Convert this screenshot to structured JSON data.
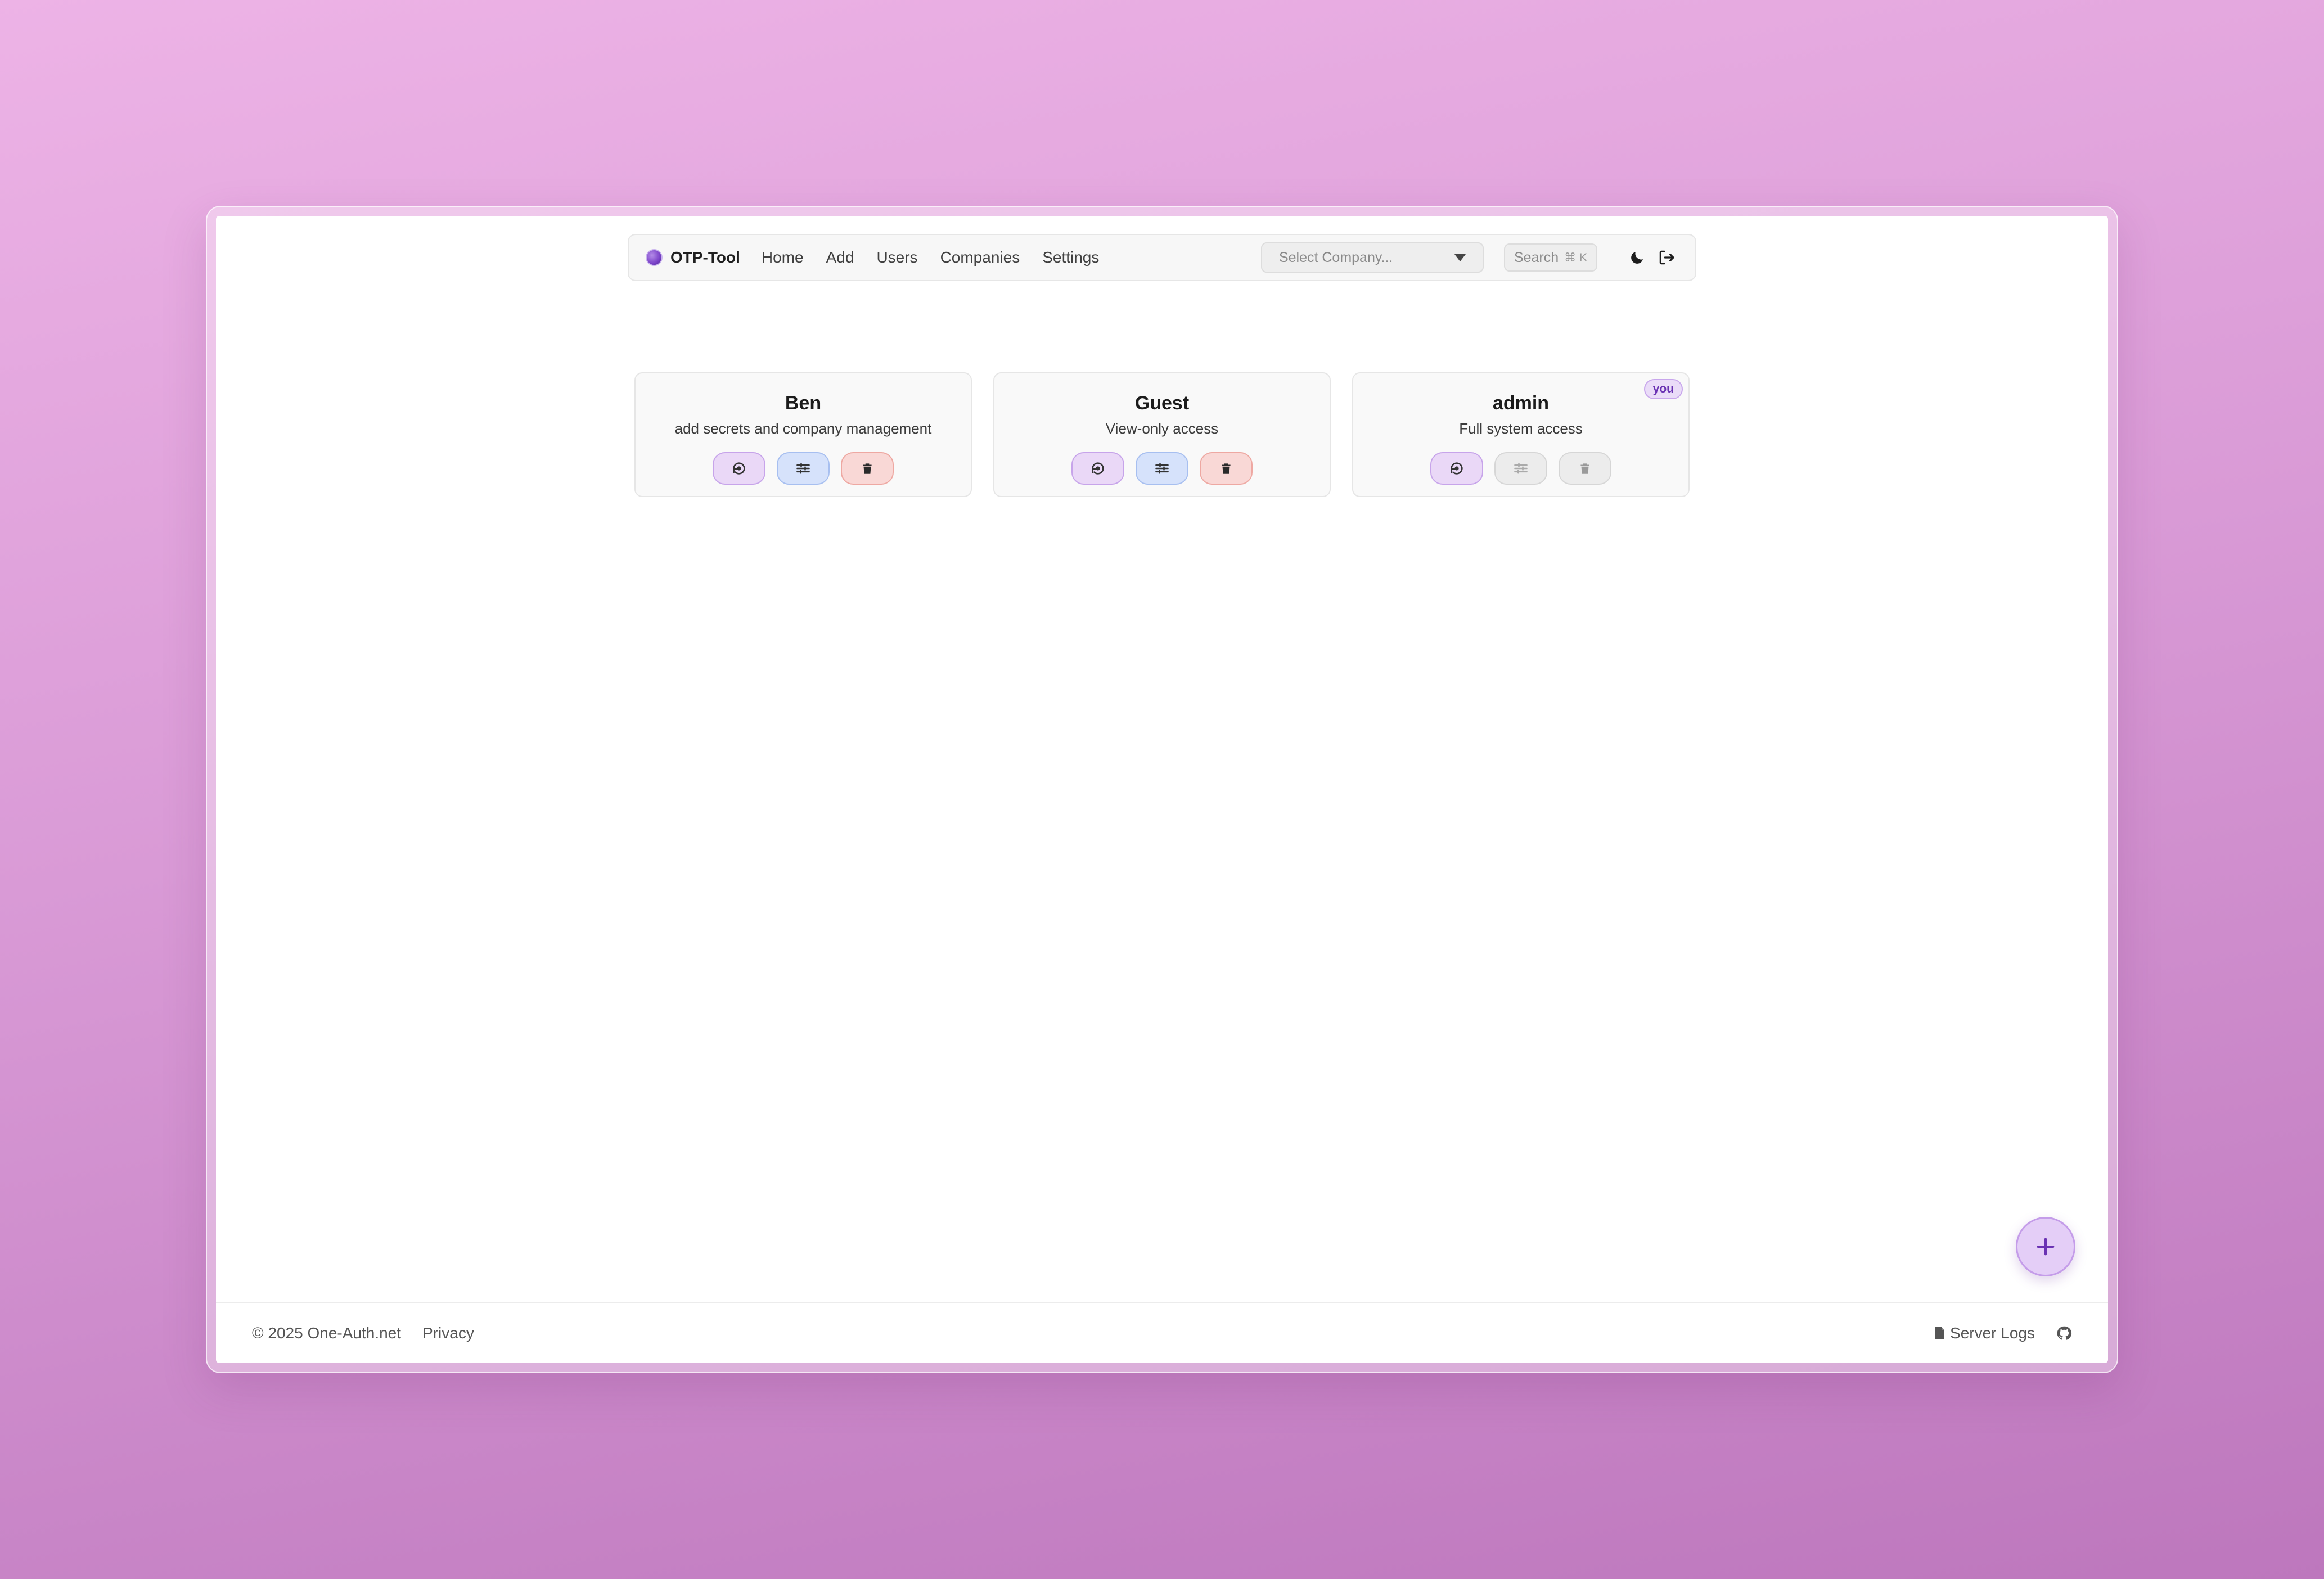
{
  "nav": {
    "brand": "OTP-Tool",
    "links": [
      {
        "label": "Home"
      },
      {
        "label": "Add"
      },
      {
        "label": "Users"
      },
      {
        "label": "Companies"
      },
      {
        "label": "Settings"
      }
    ],
    "company_select_placeholder": "Select Company...",
    "search_label": "Search",
    "search_shortcut": "⌘ K",
    "icons": [
      "moon-icon",
      "logout-icon"
    ]
  },
  "users": [
    {
      "name": "Ben",
      "role": "add secrets and company management",
      "is_current": false,
      "actions_enabled": {
        "reset": true,
        "edit": true,
        "delete": true
      }
    },
    {
      "name": "Guest",
      "role": "View-only access",
      "is_current": false,
      "actions_enabled": {
        "reset": true,
        "edit": true,
        "delete": true
      }
    },
    {
      "name": "admin",
      "role": "Full system access",
      "is_current": true,
      "badge": "you",
      "actions_enabled": {
        "reset": true,
        "edit": false,
        "delete": false
      }
    }
  ],
  "action_icons": {
    "reset": "reset-password-icon",
    "edit": "sliders-icon",
    "delete": "trash-icon"
  },
  "colors": {
    "accent_purple": "#6a32b3",
    "reset_bg": "#ead8f7",
    "edit_bg": "#d6e2fb",
    "delete_bg": "#f9d8d6",
    "disabled_bg": "#ececec"
  },
  "fab": {
    "icon": "plus-icon"
  },
  "footer": {
    "copyright": "© 2025 One-Auth.net",
    "privacy": "Privacy",
    "server_logs": "Server Logs",
    "github_icon": "github-icon"
  }
}
